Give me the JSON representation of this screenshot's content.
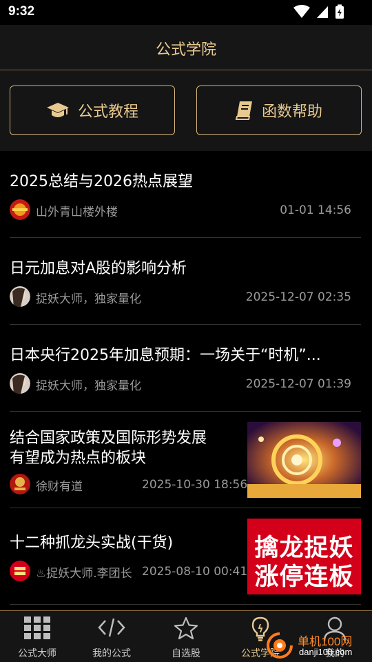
{
  "status": {
    "time": "9:32"
  },
  "header": {
    "title": "公式学院"
  },
  "buttons": {
    "tutorial": {
      "label": "公式教程",
      "icon": "graduation-cap-icon"
    },
    "help": {
      "label": "函数帮助",
      "icon": "book-icon"
    }
  },
  "articles": [
    {
      "title": "2025总结与2026热点展望",
      "author": "山外青山楼外楼",
      "time": "01-01 14:56"
    },
    {
      "title": "日元加息对A股的影响分析",
      "author": "捉妖大师，独家量化",
      "time": "2025-12-07 02:35"
    },
    {
      "title": "日本央行2025年加息预期：一场关于“时机”...",
      "author": "捉妖大师，独家量化",
      "time": "2025-12-07 01:39"
    },
    {
      "title_line1": "结合国家政策及国际形势发展",
      "title_line2": "有望成为热点的板块",
      "author": "徐财有道",
      "time": "2025-10-30 18:56"
    },
    {
      "title": "十二种抓龙头实战(干货)",
      "author": "♨捉妖大师.李团长",
      "time": "2025-08-10 00:41",
      "thumb_line1": "擒龙捉妖",
      "thumb_line2": "涨停连板",
      "thumb_color": "#d4001a"
    }
  ],
  "tabs": [
    {
      "label": "公式大师",
      "icon": "grid-icon"
    },
    {
      "label": "我的公式",
      "icon": "code-icon"
    },
    {
      "label": "自选股",
      "icon": "star-icon"
    },
    {
      "label": "公式学院",
      "icon": "lightbulb-icon",
      "active": true
    },
    {
      "label": "我的",
      "icon": "user-icon"
    }
  ],
  "watermark": {
    "site": "单机100网",
    "url": "danji100.com"
  },
  "colors": {
    "accent": "#e8c98f",
    "background": "#000000",
    "panel": "#151515"
  }
}
